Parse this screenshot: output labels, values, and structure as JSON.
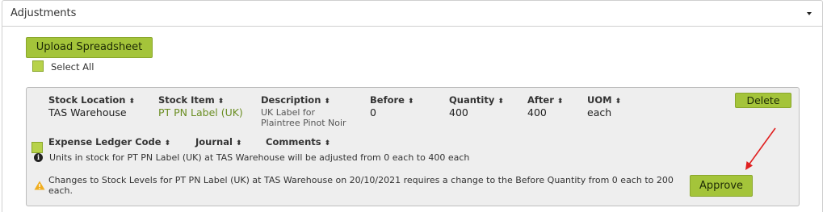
{
  "panel": {
    "title": "Adjustments"
  },
  "toolbar": {
    "upload_label": "Upload Spreadsheet",
    "select_all_label": "Select All"
  },
  "columns": {
    "stock_location": "Stock Location",
    "stock_item": "Stock Item",
    "description": "Description",
    "before": "Before",
    "quantity": "Quantity",
    "after": "After",
    "uom": "UOM",
    "expense_ledger_code": "Expense Ledger Code",
    "journal": "Journal",
    "comments": "Comments"
  },
  "sort_glyph": "⬍",
  "row": {
    "stock_location": "TAS Warehouse",
    "stock_item": "PT PN Label (UK)",
    "description": "UK Label for Plaintree Pinot Noir",
    "before": "0",
    "quantity": "400",
    "after": "400",
    "uom": "each",
    "delete_label": "Delete",
    "info_message": "Units in stock for PT PN Label (UK) at TAS Warehouse will be adjusted from 0 each to 400 each",
    "warning_message": "Changes to Stock Levels for PT PN Label (UK) at TAS Warehouse on 20/10/2021 requires a change to the Before Quantity from 0 each to 200 each.",
    "approve_label": "Approve"
  },
  "icons": {
    "dropdown": "caret-down-icon",
    "info": "info-icon",
    "warning": "warning-icon",
    "annotation": "red-arrow-annotation"
  },
  "colors": {
    "button": "#a4c43a",
    "link": "#6b8e23",
    "warning": "#f0ad1e",
    "annotation": "#e02020"
  }
}
